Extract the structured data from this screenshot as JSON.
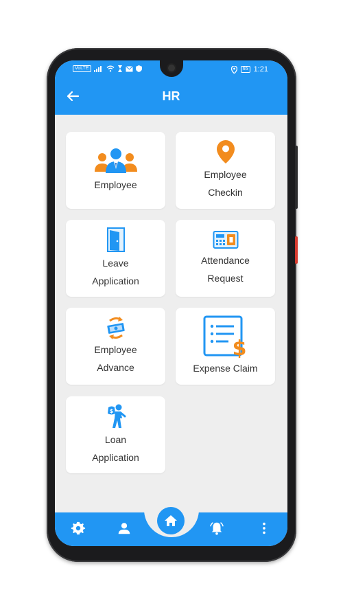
{
  "status_bar": {
    "left_badge": "VoLTE",
    "battery": "65",
    "time": "1:21"
  },
  "app_bar": {
    "title": "HR"
  },
  "tiles": [
    {
      "line1": "Employee",
      "line2": "",
      "icon": "employee-group-icon"
    },
    {
      "line1": "Employee",
      "line2": "Checkin",
      "icon": "location-pin-icon"
    },
    {
      "line1": "Leave",
      "line2": "Application",
      "icon": "door-icon"
    },
    {
      "line1": "Attendance",
      "line2": "Request",
      "icon": "attendance-device-icon"
    },
    {
      "line1": "Employee",
      "line2": "Advance",
      "icon": "money-exchange-icon"
    },
    {
      "line1": "Expense Claim",
      "line2": "",
      "icon": "expense-list-icon"
    },
    {
      "line1": "Loan",
      "line2": "Application",
      "icon": "loan-person-icon"
    }
  ],
  "bottom_nav": {
    "items": [
      "settings-icon",
      "user-icon",
      "home-icon",
      "bell-icon",
      "more-vertical-icon"
    ]
  },
  "colors": {
    "primary": "#2196f3",
    "accent_orange": "#f28c1e",
    "background": "#eeeeee",
    "card": "#ffffff"
  }
}
